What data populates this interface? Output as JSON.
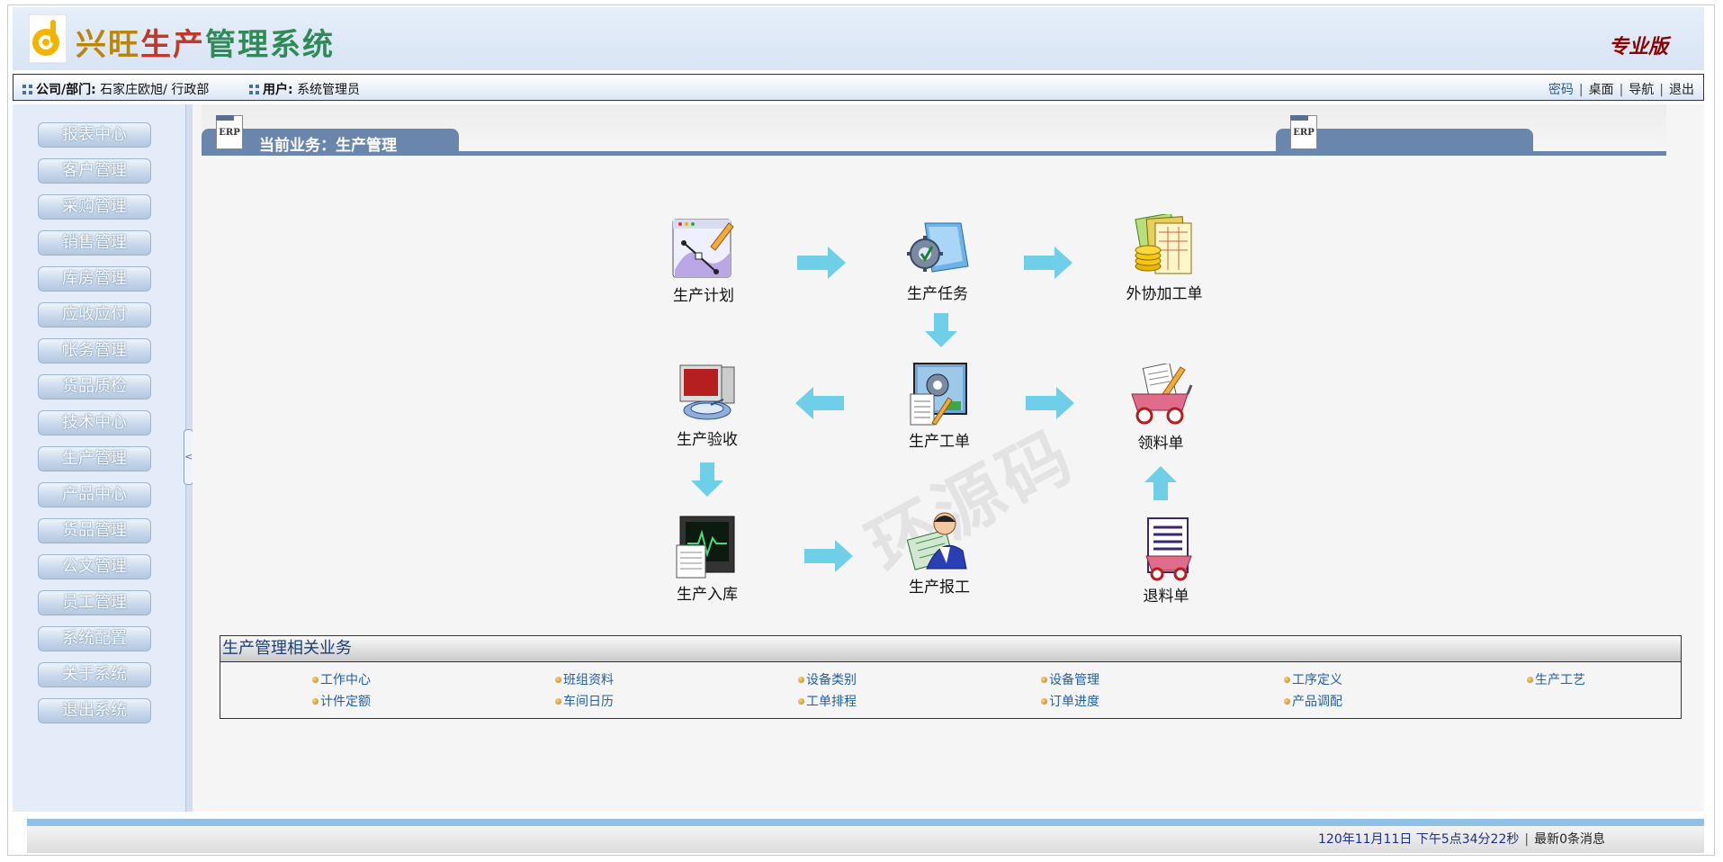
{
  "header": {
    "title_part1": "兴旺",
    "title_part2": "生产",
    "title_part3": "管理系统",
    "edition": "专业版",
    "logo_icon": "logo-g-icon"
  },
  "infobar": {
    "company_label": "公司/部门:",
    "company_value": "石家庄欧旭/ 行政部",
    "user_label": "用户:",
    "user_value": "系统管理员",
    "links": [
      "密码",
      "桌面",
      "导航",
      "退出"
    ]
  },
  "sidebar": {
    "items": [
      "报表中心",
      "客户管理",
      "采购管理",
      "销售管理",
      "库房管理",
      "应收应付",
      "帐务管理",
      "货品质检",
      "技术中心",
      "生产管理",
      "产品中心",
      "货品管理",
      "公文管理",
      "员工管理",
      "系统配置",
      "关于系统",
      "退出系统"
    ]
  },
  "main": {
    "current_business": "当前业务：生产管理",
    "tab_icon_text": "ERP",
    "flow": {
      "plan": "生产计划",
      "task": "生产任务",
      "outsource": "外协加工单",
      "acceptance": "生产验收",
      "workorder": "生产工单",
      "requisition": "领料单",
      "warehousing": "生产入库",
      "report": "生产报工",
      "return": "退料单"
    },
    "watermark": "环源码",
    "related": {
      "title": "生产管理相关业务",
      "row1": [
        "工作中心",
        "班组资料",
        "设备类别",
        "设备管理",
        "工序定义",
        "生产工艺"
      ],
      "row2": [
        "计件定额",
        "车间日历",
        "工单排程",
        "订单进度",
        "产品调配"
      ]
    }
  },
  "footer": {
    "datetime": "120年11月11日 下午5点34分22秒",
    "messages": "最新0条消息"
  },
  "colors": {
    "tab_blue": "#6b86ac",
    "arrow_cyan": "#6fcfe8",
    "link_blue": "#1f5fa8"
  }
}
